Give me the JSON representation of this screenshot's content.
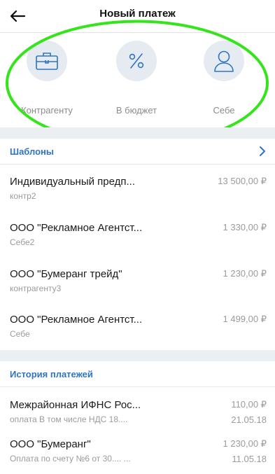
{
  "header": {
    "title": "Новый платеж",
    "back_icon": "arrow-left-icon"
  },
  "quick_actions": [
    {
      "label": "Контрагенту",
      "icon": "briefcase-icon"
    },
    {
      "label": "В бюджет",
      "icon": "percent-icon"
    },
    {
      "label": "Себе",
      "icon": "person-icon"
    }
  ],
  "templates": {
    "title": "Шаблоны",
    "items": [
      {
        "name": "Индивидуальный предп...",
        "note": "контр2",
        "amount": "13 500,00 ₽"
      },
      {
        "name": "ООО \"Рекламное Агентст...",
        "note": "Себе2",
        "amount": "1 330,00 ₽"
      },
      {
        "name": "ООО \"Бумеранг трейд\"",
        "note": "контрагенту3",
        "amount": "1 230,00 ₽"
      },
      {
        "name": "ООО \"Рекламное Агентст...",
        "note": "Себе",
        "amount": "1 499,00 ₽"
      }
    ]
  },
  "history": {
    "title": "История платежей",
    "items": [
      {
        "name": "Межрайонная ИФНС Рос...",
        "note": "оплата В том числе НДС 18....",
        "amount": "110,00 ₽",
        "date": "21.05.18"
      },
      {
        "name": "ООО \"Бумеранг\"",
        "note": "Оплата по счету №6 от 30.... ...",
        "amount": "1 230,00 ₽",
        "date": "11.05.18"
      }
    ]
  },
  "colors": {
    "accent": "#2d74c6",
    "highlight": "#33e51a",
    "icon_stroke": "#2d74c6",
    "circle_bg": "#e6ebf1"
  }
}
